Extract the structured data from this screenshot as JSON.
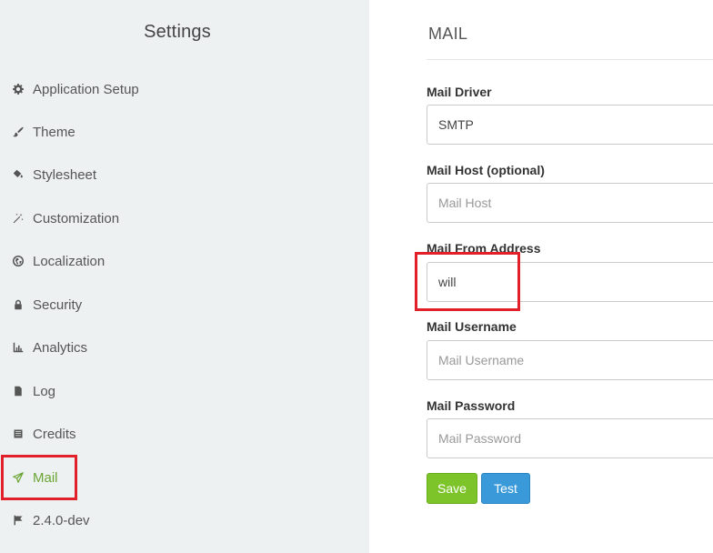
{
  "sidebar": {
    "title": "Settings",
    "items": [
      {
        "label": "Application Setup",
        "icon": "gear-icon"
      },
      {
        "label": "Theme",
        "icon": "brush-icon"
      },
      {
        "label": "Stylesheet",
        "icon": "paint-bucket-icon"
      },
      {
        "label": "Customization",
        "icon": "magic-wand-icon"
      },
      {
        "label": "Localization",
        "icon": "globe-icon"
      },
      {
        "label": "Security",
        "icon": "lock-icon"
      },
      {
        "label": "Analytics",
        "icon": "bar-chart-icon"
      },
      {
        "label": "Log",
        "icon": "file-icon"
      },
      {
        "label": "Credits",
        "icon": "list-icon"
      },
      {
        "label": "Mail",
        "icon": "paper-plane-icon",
        "active": true
      },
      {
        "label": "2.4.0-dev",
        "icon": "flag-icon"
      }
    ]
  },
  "main": {
    "title": "MAIL",
    "fields": [
      {
        "label": "Mail Driver",
        "value": "SMTP",
        "placeholder": ""
      },
      {
        "label": "Mail Host (optional)",
        "value": "",
        "placeholder": "Mail Host"
      },
      {
        "label": "Mail From Address",
        "value": "will",
        "placeholder": ""
      },
      {
        "label": "Mail Username",
        "value": "",
        "placeholder": "Mail Username"
      },
      {
        "label": "Mail Password",
        "value": "",
        "placeholder": "Mail Password"
      }
    ],
    "buttons": {
      "save": "Save",
      "test": "Test"
    }
  },
  "colors": {
    "active": "#6aa534",
    "save": "#7dc42a",
    "test": "#3a9ad9",
    "highlight": "#e2202a"
  }
}
